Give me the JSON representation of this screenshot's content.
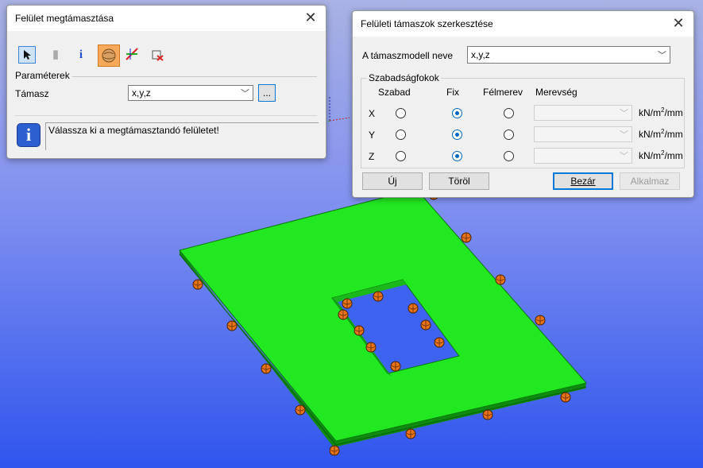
{
  "left_dialog": {
    "title": "Felület megtámasztása",
    "group_label": "Paraméterek",
    "support_label": "Támasz",
    "support_value": "x,y,z",
    "browse_label": "...",
    "info_text": "Válassza ki a megtámasztandó felületet!"
  },
  "right_dialog": {
    "title": "Felületi támaszok szerkesztése",
    "model_name_label": "A támaszmodell neve",
    "model_name_value": "x,y,z",
    "dof_group_label": "Szabadságfokok",
    "columns": [
      "Szabad",
      "Fix",
      "Félmerev",
      "Merevség"
    ],
    "rows": [
      {
        "axis": "X",
        "selected": "Fix",
        "unit_base": "kN/m",
        "unit_exp": "2",
        "unit_tail": "/mm"
      },
      {
        "axis": "Y",
        "selected": "Fix",
        "unit_base": "kN/m",
        "unit_exp": "2",
        "unit_tail": "/mm"
      },
      {
        "axis": "Z",
        "selected": "Fix",
        "unit_base": "kN/m",
        "unit_exp": "2",
        "unit_tail": "/mm"
      }
    ],
    "buttons": {
      "new": "Új",
      "delete": "Töröl",
      "close": "Bezár",
      "apply": "Alkalmaz"
    }
  },
  "scene": {
    "plate_color": "#1ee01e",
    "support_color": "#e8741a"
  }
}
